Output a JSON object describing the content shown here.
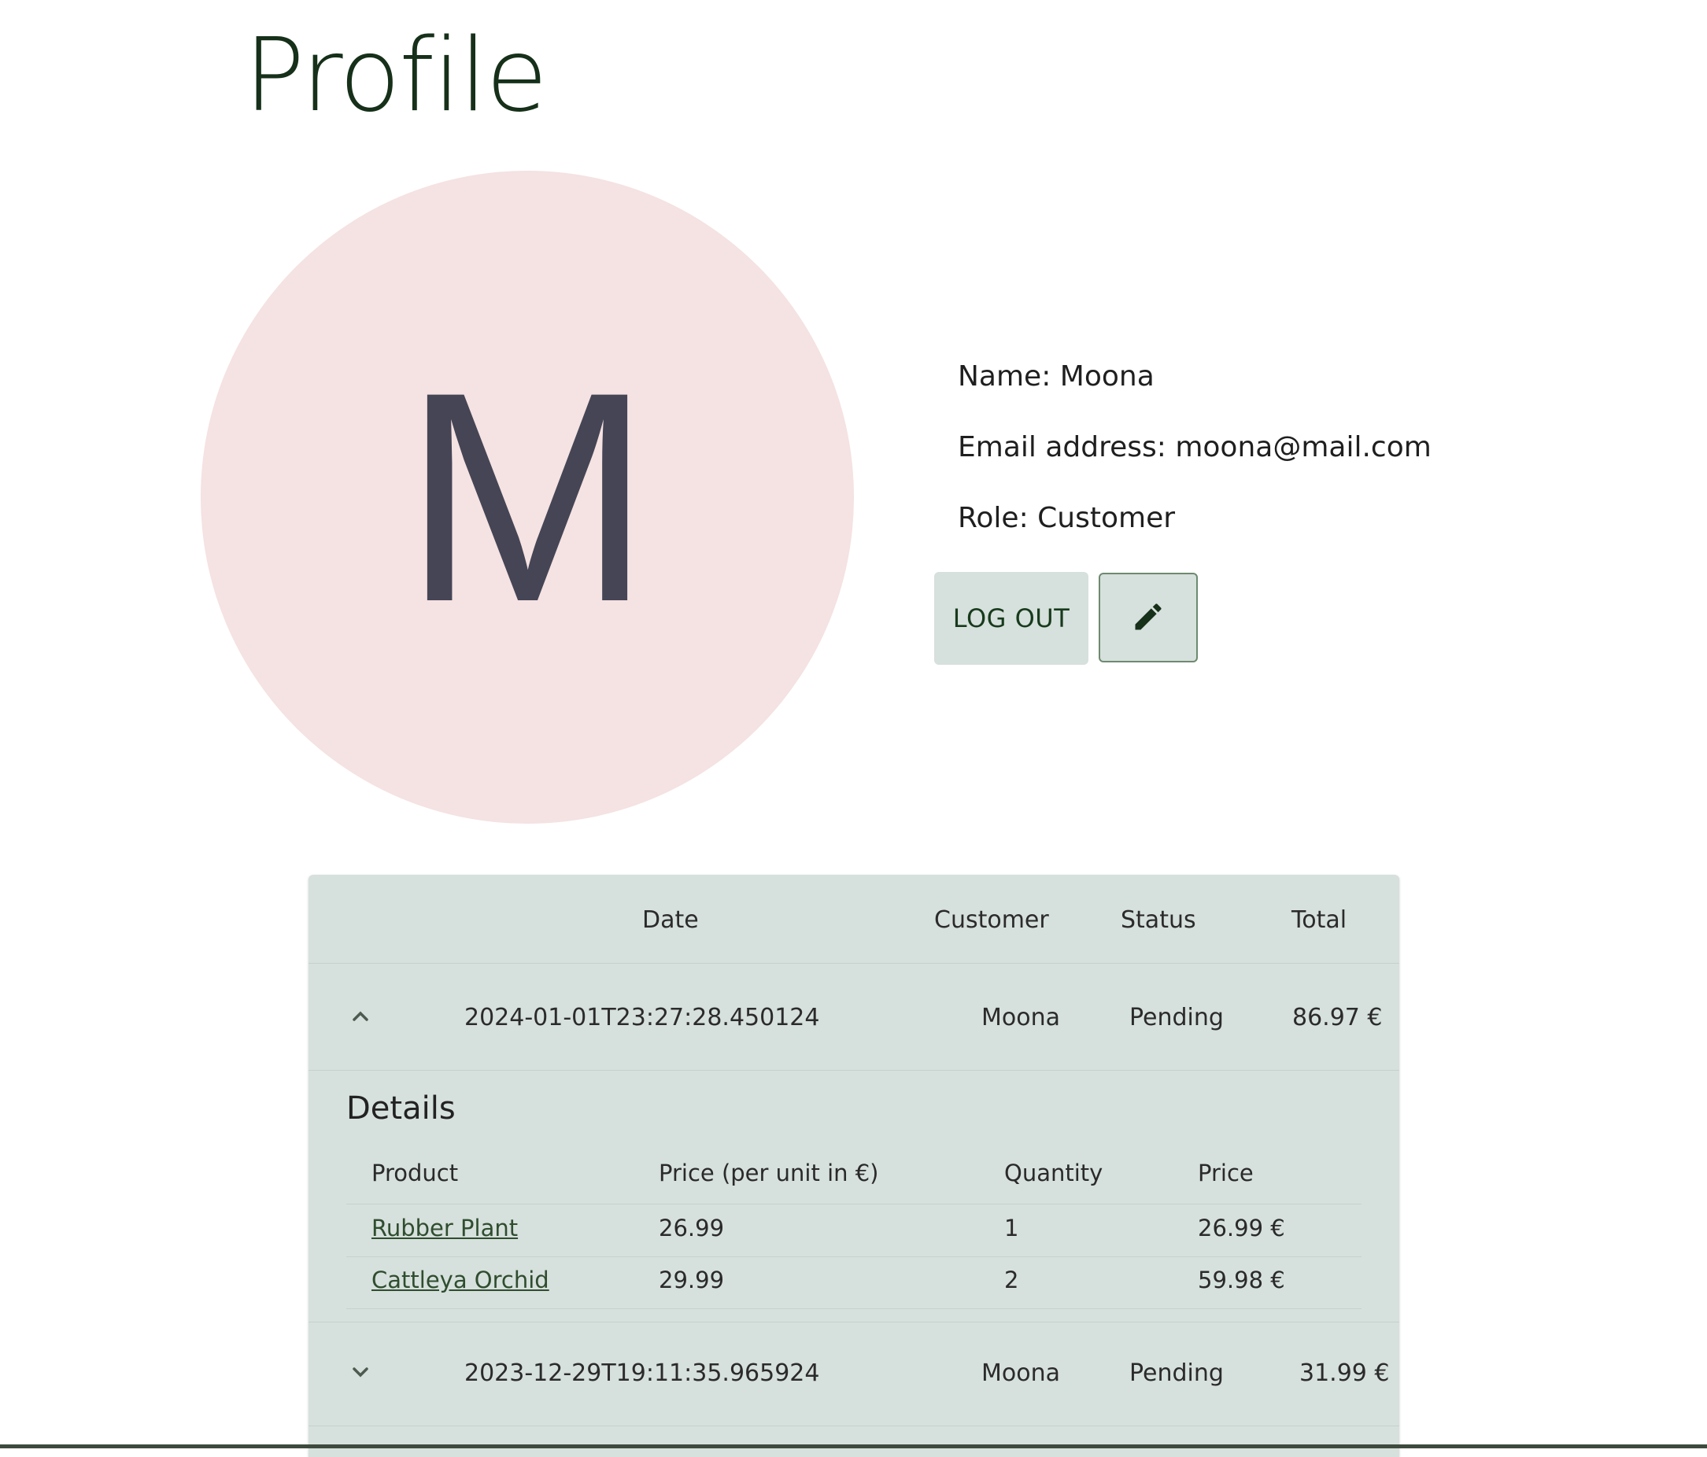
{
  "page": {
    "title": "Profile"
  },
  "avatar": {
    "letter": "M",
    "bg": "#f5e2e2",
    "fg": "#454555"
  },
  "profile": {
    "name_line": "Name: Moona",
    "email_line": "Email address: moona@mail.com",
    "role_line": "Role: Customer"
  },
  "actions": {
    "logout_label": "LOG OUT",
    "edit_icon": "pencil-icon"
  },
  "orders": {
    "headers": {
      "date": "Date",
      "customer": "Customer",
      "status": "Status",
      "total": "Total"
    },
    "rows": [
      {
        "date": "2024-01-01T23:27:28.450124",
        "customer": "Moona",
        "status": "Pending",
        "total": "86.97 €",
        "expanded": true
      },
      {
        "date": "2023-12-29T19:11:35.965924",
        "customer": "Moona",
        "status": "Pending",
        "total": "31.99 €",
        "expanded": false
      }
    ],
    "details": {
      "title": "Details",
      "headers": {
        "product": "Product",
        "unit_price": "Price (per unit in €)",
        "quantity": "Quantity",
        "price": "Price"
      },
      "items": [
        {
          "product": "Rubber Plant",
          "unit_price": "26.99",
          "quantity": "1",
          "price": "26.99 €"
        },
        {
          "product": "Cattleya Orchid",
          "unit_price": "29.99",
          "quantity": "2",
          "price": "59.98 €"
        }
      ]
    }
  },
  "colors": {
    "accent": "#16301a",
    "panel": "#d6e0dc"
  }
}
